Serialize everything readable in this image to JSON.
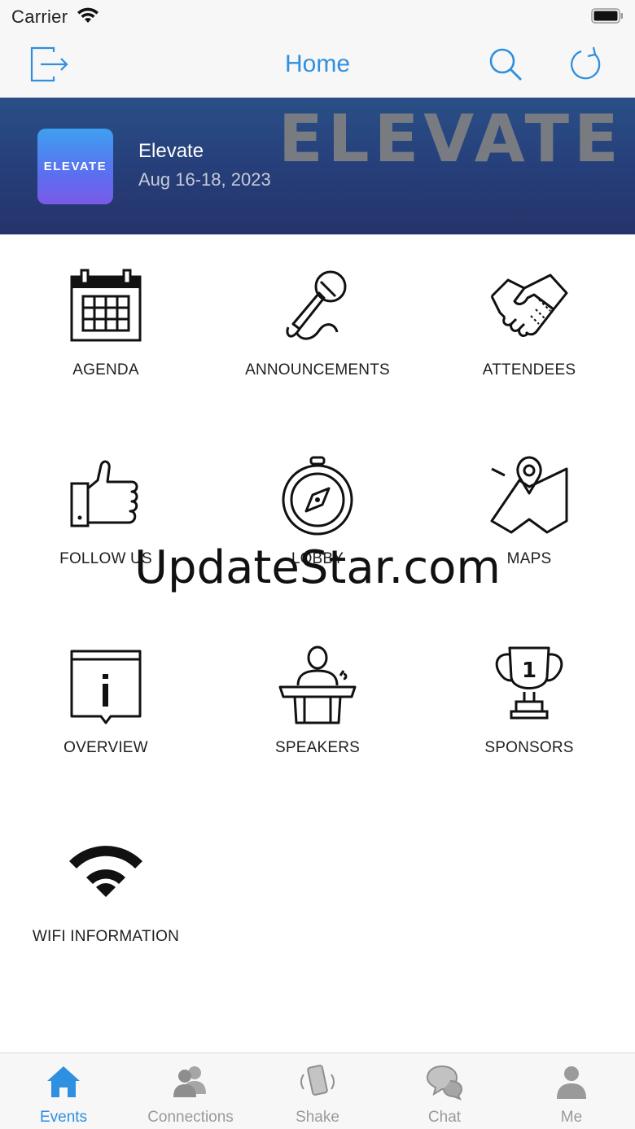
{
  "status_bar": {
    "carrier": "Carrier"
  },
  "nav": {
    "title": "Home",
    "accent": "#2f8fe0"
  },
  "banner": {
    "wordmark": "ELEVATE",
    "logo_text": "ELEVATE",
    "event_name": "Elevate",
    "event_dates": "Aug 16-18, 2023"
  },
  "grid": {
    "items": [
      {
        "label": "AGENDA",
        "icon": "calendar-icon"
      },
      {
        "label": "ANNOUNCEMENTS",
        "icon": "microphone-icon"
      },
      {
        "label": "ATTENDEES",
        "icon": "handshake-icon"
      },
      {
        "label": "FOLLOW US",
        "icon": "thumbs-up-icon"
      },
      {
        "label": "LOBBY",
        "icon": "compass-icon"
      },
      {
        "label": "MAPS",
        "icon": "map-icon"
      },
      {
        "label": "OVERVIEW",
        "icon": "info-icon"
      },
      {
        "label": "SPEAKERS",
        "icon": "podium-icon"
      },
      {
        "label": "SPONSORS",
        "icon": "trophy-icon"
      },
      {
        "label": "WIFI INFORMATION",
        "icon": "wifi-icon"
      }
    ]
  },
  "watermark": "UpdateStar.com",
  "tabs": [
    {
      "label": "Events",
      "icon": "home-icon",
      "active": true
    },
    {
      "label": "Connections",
      "icon": "people-icon",
      "active": false
    },
    {
      "label": "Shake",
      "icon": "shake-phone-icon",
      "active": false
    },
    {
      "label": "Chat",
      "icon": "chat-bubbles-icon",
      "active": false
    },
    {
      "label": "Me",
      "icon": "person-icon",
      "active": false
    }
  ]
}
